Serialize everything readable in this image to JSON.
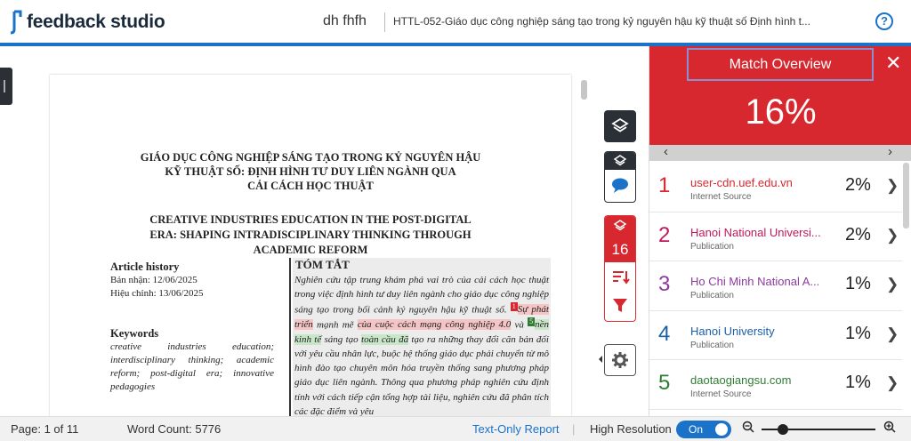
{
  "header": {
    "logo_text": "feedback studio",
    "author": "dh fhfh",
    "doc_title": "HTTL-052-Giáo dục công nghiệp sáng tạo trong kỷ nguyên hậu kỹ thuật số Định hình t...",
    "help_label": "?"
  },
  "document": {
    "vn_title_1": "GIÁO DỤC CÔNG NGHIỆP SÁNG TẠO TRONG KỶ NGUYÊN HẬU",
    "vn_title_2": "KỸ THUẬT SỐ: ĐỊNH HÌNH TƯ DUY LIÊN NGÀNH QUA",
    "vn_title_3": "CẢI CÁCH HỌC THUẬT",
    "en_title_1": "CREATIVE INDUSTRIES EDUCATION IN THE POST-DIGITAL",
    "en_title_2": "ERA: SHAPING INTRADISCIPLINARY THINKING THROUGH",
    "en_title_3": "ACADEMIC REFORM",
    "article_history_heading": "Article history",
    "received": "Bản nhận: 12/06/2025",
    "revised": "Hiệu chỉnh: 13/06/2025",
    "keywords_heading": "Keywords",
    "keywords_text": "creative industries education; interdisciplinary thinking; academic reform; post-digital era; innovative pedagogies",
    "summary_heading": "TÓM TẮT",
    "summary_a": "Nghiên cứu tập trung khám phá vai trò của cải cách học thuật trong việc định hình tư duy liên ngành cho giáo dục công nghiệp sáng tạo trong bối cảnh kỷ nguyên hậu kỹ thuật số. ",
    "summary_hl1": "Sự phát triển",
    "summary_b": " mạnh mẽ ",
    "summary_hl2": "của cuộc cách mạng công nghiệp 4.0",
    "summary_c": " và ",
    "summary_hl3": "nền kinh tế",
    "summary_d": " sáng tạo ",
    "summary_hl4": "toàn cầu đã",
    "summary_e": " tạo ra những thay đổi căn bản đối với yêu cầu nhân lực, buộc hệ thống giáo dục phải chuyển từ mô hình đào tạo chuyên môn hóa truyền thống sang phương pháp giáo dục liên ngành. Thông qua phương pháp nghiên cứu định tính với cách tiếp cận tổng hợp tài liệu, nghiên cứu đã phân tích các đặc điểm và yêu",
    "marker_1": "1",
    "marker_5": "5"
  },
  "tools": {
    "match_count": "16"
  },
  "panel": {
    "title": "Match Overview",
    "percent": "16%",
    "close_label": "✕",
    "matches": [
      {
        "num": "1",
        "source": "user-cdn.uef.edu.vn",
        "type": "Internet Source",
        "pct": "2%",
        "color": "#d7282f"
      },
      {
        "num": "2",
        "source": "Hanoi National Universi...",
        "type": "Publication",
        "pct": "2%",
        "color": "#c2185b"
      },
      {
        "num": "3",
        "source": "Ho Chi Minh National A...",
        "type": "Publication",
        "pct": "1%",
        "color": "#8e3a9e"
      },
      {
        "num": "4",
        "source": "Hanoi University",
        "type": "Publication",
        "pct": "1%",
        "color": "#1a5fa8"
      },
      {
        "num": "5",
        "source": "daotaogiangsu.com",
        "type": "Internet Source",
        "pct": "1%",
        "color": "#2e7d32"
      }
    ]
  },
  "footer": {
    "page": "Page: 1 of 11",
    "word_count": "Word Count: 5776",
    "text_only": "Text-Only Report",
    "high_res": "High Resolution",
    "toggle": "On"
  }
}
